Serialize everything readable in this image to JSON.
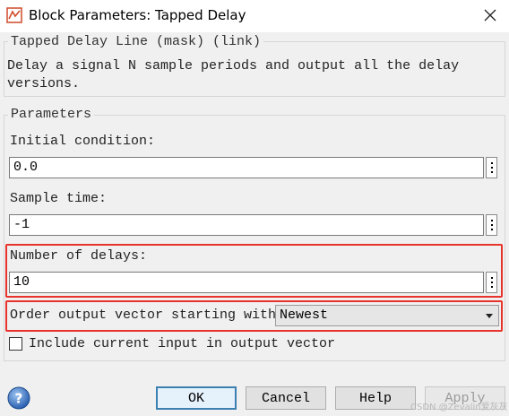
{
  "window": {
    "title": "Block Parameters: Tapped Delay",
    "close_glyph": "✕"
  },
  "mask_group": {
    "legend": "Tapped Delay Line (mask) (link)",
    "description": "Delay a signal N sample periods and output all the delay versions."
  },
  "parameters": {
    "legend": "Parameters",
    "initial_condition": {
      "label": "Initial condition:",
      "value": "0.0"
    },
    "sample_time": {
      "label": "Sample time:",
      "value": "-1"
    },
    "number_of_delays": {
      "label": "Number of delays:",
      "value": "10"
    },
    "order_output": {
      "label": "Order output vector starting with:",
      "selected": "Newest"
    },
    "include_current": {
      "label": "Include current input in output vector",
      "checked": false
    }
  },
  "buttons": {
    "ok": "OK",
    "cancel": "Cancel",
    "help": "Help",
    "apply": "Apply"
  },
  "watermark": "CSDN @Zevalin爱灰灰",
  "colors": {
    "highlight": "#e8332c",
    "primary_border": "#3c7fb1"
  },
  "icons": [
    "simulink-block-icon",
    "close-icon",
    "more-options-icon",
    "chevron-down-icon",
    "help-icon"
  ]
}
